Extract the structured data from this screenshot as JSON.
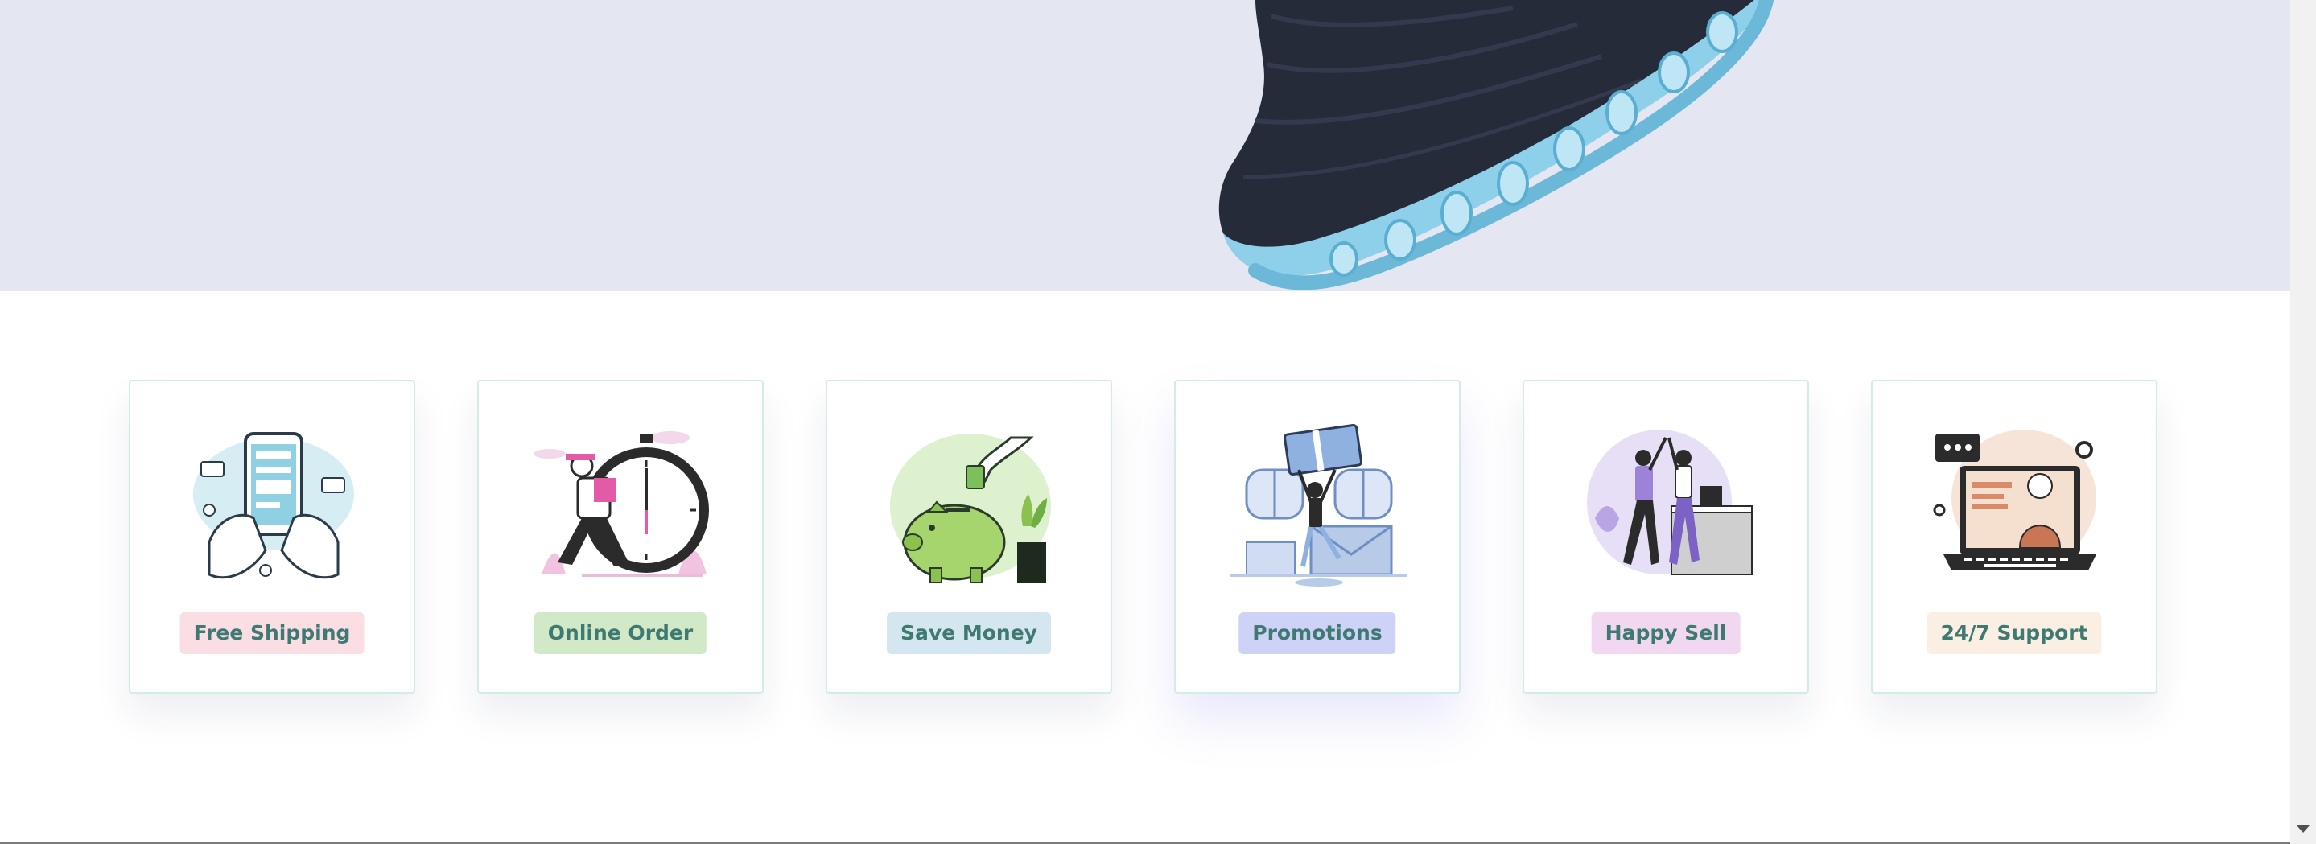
{
  "hero": {
    "image": "sneaker-image",
    "background": "#e4e6f1"
  },
  "features": [
    {
      "label": "Free Shipping",
      "icon": "mobile-payment-icon",
      "badge_color": "#fbdde4"
    },
    {
      "label": "Online Order",
      "icon": "stopwatch-delivery-icon",
      "badge_color": "#d2e9c8"
    },
    {
      "label": "Save Money",
      "icon": "piggy-bank-icon",
      "badge_color": "#d4e6ef"
    },
    {
      "label": "Promotions",
      "icon": "gift-promotion-icon",
      "badge_color": "#cdd2f6"
    },
    {
      "label": "Happy Sell",
      "icon": "high-five-icon",
      "badge_color": "#f1d7f0"
    },
    {
      "label": "24/7 Support",
      "icon": "laptop-support-icon",
      "badge_color": "#fbeee3"
    }
  ],
  "colors": {
    "badge_text": "#3f7a72",
    "card_border": "#d4ece4"
  }
}
